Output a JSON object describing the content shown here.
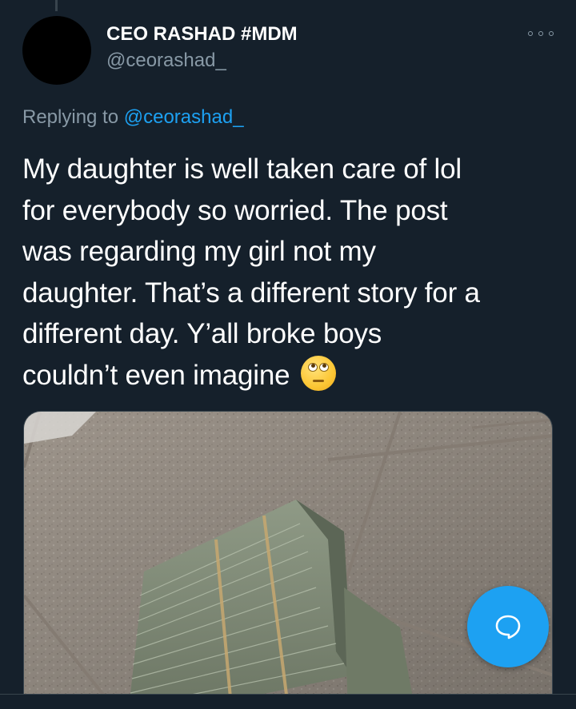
{
  "tweet": {
    "display_name": "CEO RASHAD #MDM",
    "handle": "@ceorashad_",
    "replying_prefix": "Replying to ",
    "replying_to": "@ceorashad_",
    "text_lines": [
      "My daughter is well taken care of lol",
      "for everybody so worried. The post",
      "was regarding my girl not my",
      "daughter. That’s a different story for a",
      "different day. Y’all broke boys",
      "couldn’t even imagine"
    ],
    "emoji": "face-with-rolling-eyes-icon",
    "media_description_icon": "photo-stacks-of-cash"
  },
  "icons": {
    "more": "more-options-icon",
    "compose_reply": "compose-reply-icon"
  },
  "colors": {
    "background": "#15202b",
    "text": "#ffffff",
    "muted": "#8899a6",
    "accent": "#1da1f2",
    "divider": "#38444d"
  }
}
